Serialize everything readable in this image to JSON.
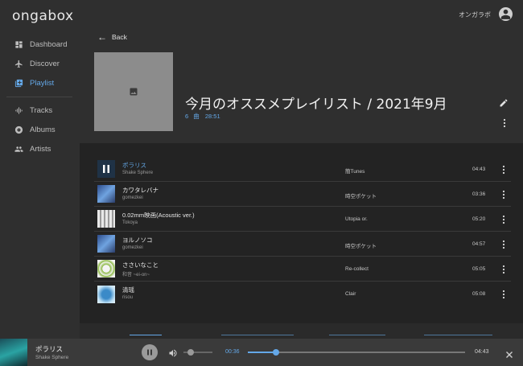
{
  "app": {
    "logo": "ongabox"
  },
  "sidebar": {
    "items": [
      {
        "label": "Dashboard",
        "icon": "dashboard-icon",
        "active": false
      },
      {
        "label": "Discover",
        "icon": "airplane-icon",
        "active": false
      },
      {
        "label": "Playlist",
        "icon": "playlist-icon",
        "active": true
      },
      {
        "label": "Tracks",
        "icon": "equalizer-icon",
        "active": false
      },
      {
        "label": "Albums",
        "icon": "disc-icon",
        "active": false
      },
      {
        "label": "Artists",
        "icon": "people-icon",
        "active": false
      }
    ]
  },
  "header": {
    "user_name": "オンガラボ",
    "back_label": "Back",
    "playlist_title": "今月のオススメプレイリスト / 2021年9月",
    "track_count": "6",
    "count_unit": "曲",
    "total_duration": "28:51"
  },
  "tracks": [
    {
      "title": "ポラリス",
      "artist": "Shake Sphere",
      "album": "簡Tunes",
      "duration": "04:43",
      "playing": true
    },
    {
      "title": "カワタレバナ",
      "artist": "gomezkei",
      "album": "時空ポケット",
      "duration": "03:36",
      "playing": false
    },
    {
      "title": "0.02mm映画(Acoustic ver.)",
      "artist": "Tokoya",
      "album": "Utopia or.",
      "duration": "05:20",
      "playing": false
    },
    {
      "title": "ヨルノソコ",
      "artist": "gomezkei",
      "album": "時空ポケット",
      "duration": "04:57",
      "playing": false
    },
    {
      "title": "ささいなこと",
      "artist": "和音 ~ei-on~",
      "album": "Re-collect",
      "duration": "05:05",
      "playing": false
    },
    {
      "title": "清瑶",
      "artist": "risou",
      "album": "Clair",
      "duration": "05:08",
      "playing": false
    }
  ],
  "player": {
    "title": "ポラリス",
    "artist": "Shake Sphere",
    "current_time": "00:36",
    "total_time": "04:43",
    "progress": 0.13,
    "volume": 0.3
  },
  "colors": {
    "accent": "#64a8e8",
    "background": "#2f2f2f",
    "list_background": "#232323",
    "player_background": "#3a3a3a"
  }
}
